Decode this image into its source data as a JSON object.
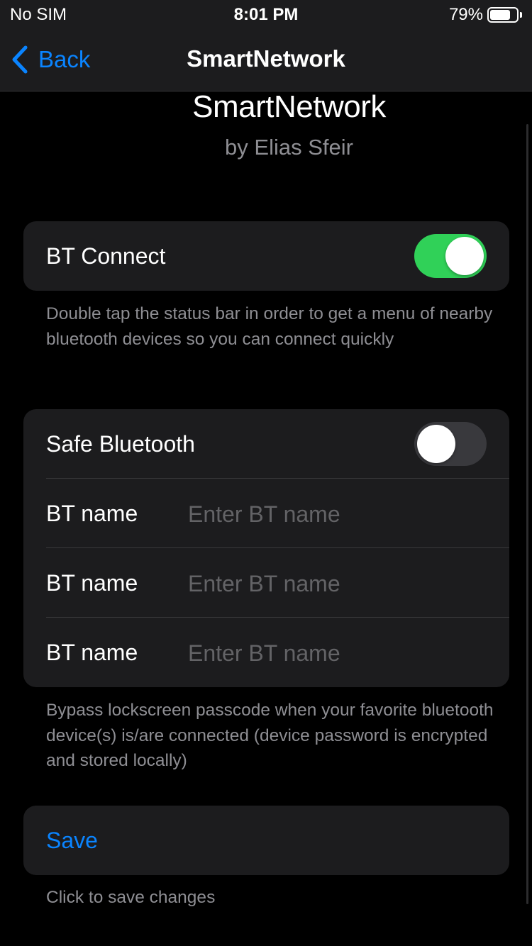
{
  "status_bar": {
    "carrier": "No SIM",
    "time": "8:01 PM",
    "battery_text": "79%",
    "battery_level": 0.79
  },
  "nav": {
    "back_label": "Back",
    "title": "SmartNetwork"
  },
  "header": {
    "title": "SmartNetwork",
    "subtitle": "by Elias Sfeir"
  },
  "bt_connect": {
    "label": "BT Connect",
    "enabled": true,
    "footer": "Double tap the status bar in order to get a menu of nearby bluetooth devices so you can connect quickly"
  },
  "safe_bluetooth": {
    "label": "Safe Bluetooth",
    "enabled": false,
    "fields": [
      {
        "label": "BT name",
        "value": "",
        "placeholder": "Enter BT name"
      },
      {
        "label": "BT name",
        "value": "",
        "placeholder": "Enter BT name"
      },
      {
        "label": "BT name",
        "value": "",
        "placeholder": "Enter BT name"
      }
    ],
    "footer": "Bypass lockscreen passcode when your favorite bluetooth device(s) is/are connected (device password is encrypted and stored locally)"
  },
  "save": {
    "label": "Save",
    "footer": "Click to save changes"
  },
  "colors": {
    "accent": "#0a84ff",
    "toggle_on": "#30d158",
    "toggle_off": "#39393d",
    "group_bg": "#1c1c1e",
    "secondary_text": "#8e8e93"
  },
  "icons": {
    "back": "chevron-left-icon",
    "battery": "battery-icon"
  }
}
